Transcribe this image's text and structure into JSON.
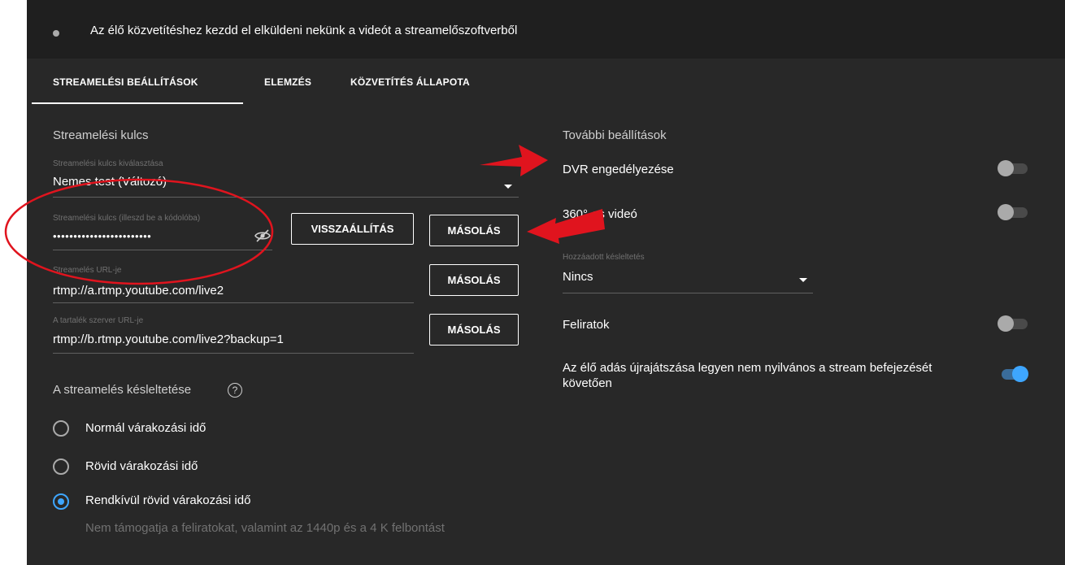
{
  "status_bar": {
    "text": "Az élő közvetítéshez kezdd el elküldeni nekünk a videót a streamelőszoftverből",
    "dot_color": "#aaaaaa"
  },
  "tabs": [
    {
      "label": "STREAMELÉSI BEÁLLÍTÁSOK",
      "active": true
    },
    {
      "label": "ELEMZÉS",
      "active": false
    },
    {
      "label": "KÖZVETÍTÉS ÁLLAPOTA",
      "active": false
    }
  ],
  "stream_key": {
    "section_title": "Streamelési kulcs",
    "select_label": "Streamelési kulcs kiválasztása",
    "select_value": "Nemes test (Változó)",
    "key_label": "Streamelési kulcs (illeszd be a kódolóba)",
    "key_value": "••••••••••••••••••••••••",
    "reset_button": "VISSZAÁLLÍTÁS",
    "copy_button": "MÁSOLÁS",
    "url_label": "Streamelés URL-je",
    "url_value": "rtmp://a.rtmp.youtube.com/live2",
    "url_copy_button": "MÁSOLÁS",
    "backup_label": "A tartalék szerver URL-je",
    "backup_value": "rtmp://b.rtmp.youtube.com/live2?backup=1",
    "backup_copy_button": "MÁSOLÁS"
  },
  "latency": {
    "title": "A streamelés késleltetése",
    "help_icon": "?",
    "options": [
      {
        "label": "Normál várakozási idő",
        "checked": false
      },
      {
        "label": "Rövid várakozási idő",
        "checked": false
      },
      {
        "label": "Rendkívül rövid várakozási idő",
        "checked": true
      }
    ],
    "note": "Nem támogatja a feliratokat, valamint az 1440p és a 4 K felbontást"
  },
  "additional": {
    "title": "További beállítások",
    "dvr_label": "DVR engedélyezése",
    "dvr_on": false,
    "video360_label": "360°-os videó",
    "video360_on": false,
    "delay_label": "Hozzáadott késleltetés",
    "delay_value": "Nincs",
    "captions_label": "Feliratok",
    "captions_on": false,
    "unlisted_label": "Az élő adás újrajátszása legyen nem nyilvános a stream befejezését követően",
    "unlisted_on": true
  },
  "colors": {
    "panel_bg": "#282828",
    "status_bg": "#1f1f1f",
    "accent_blue": "#3ea6ff",
    "annotation_red": "#e0141e"
  }
}
